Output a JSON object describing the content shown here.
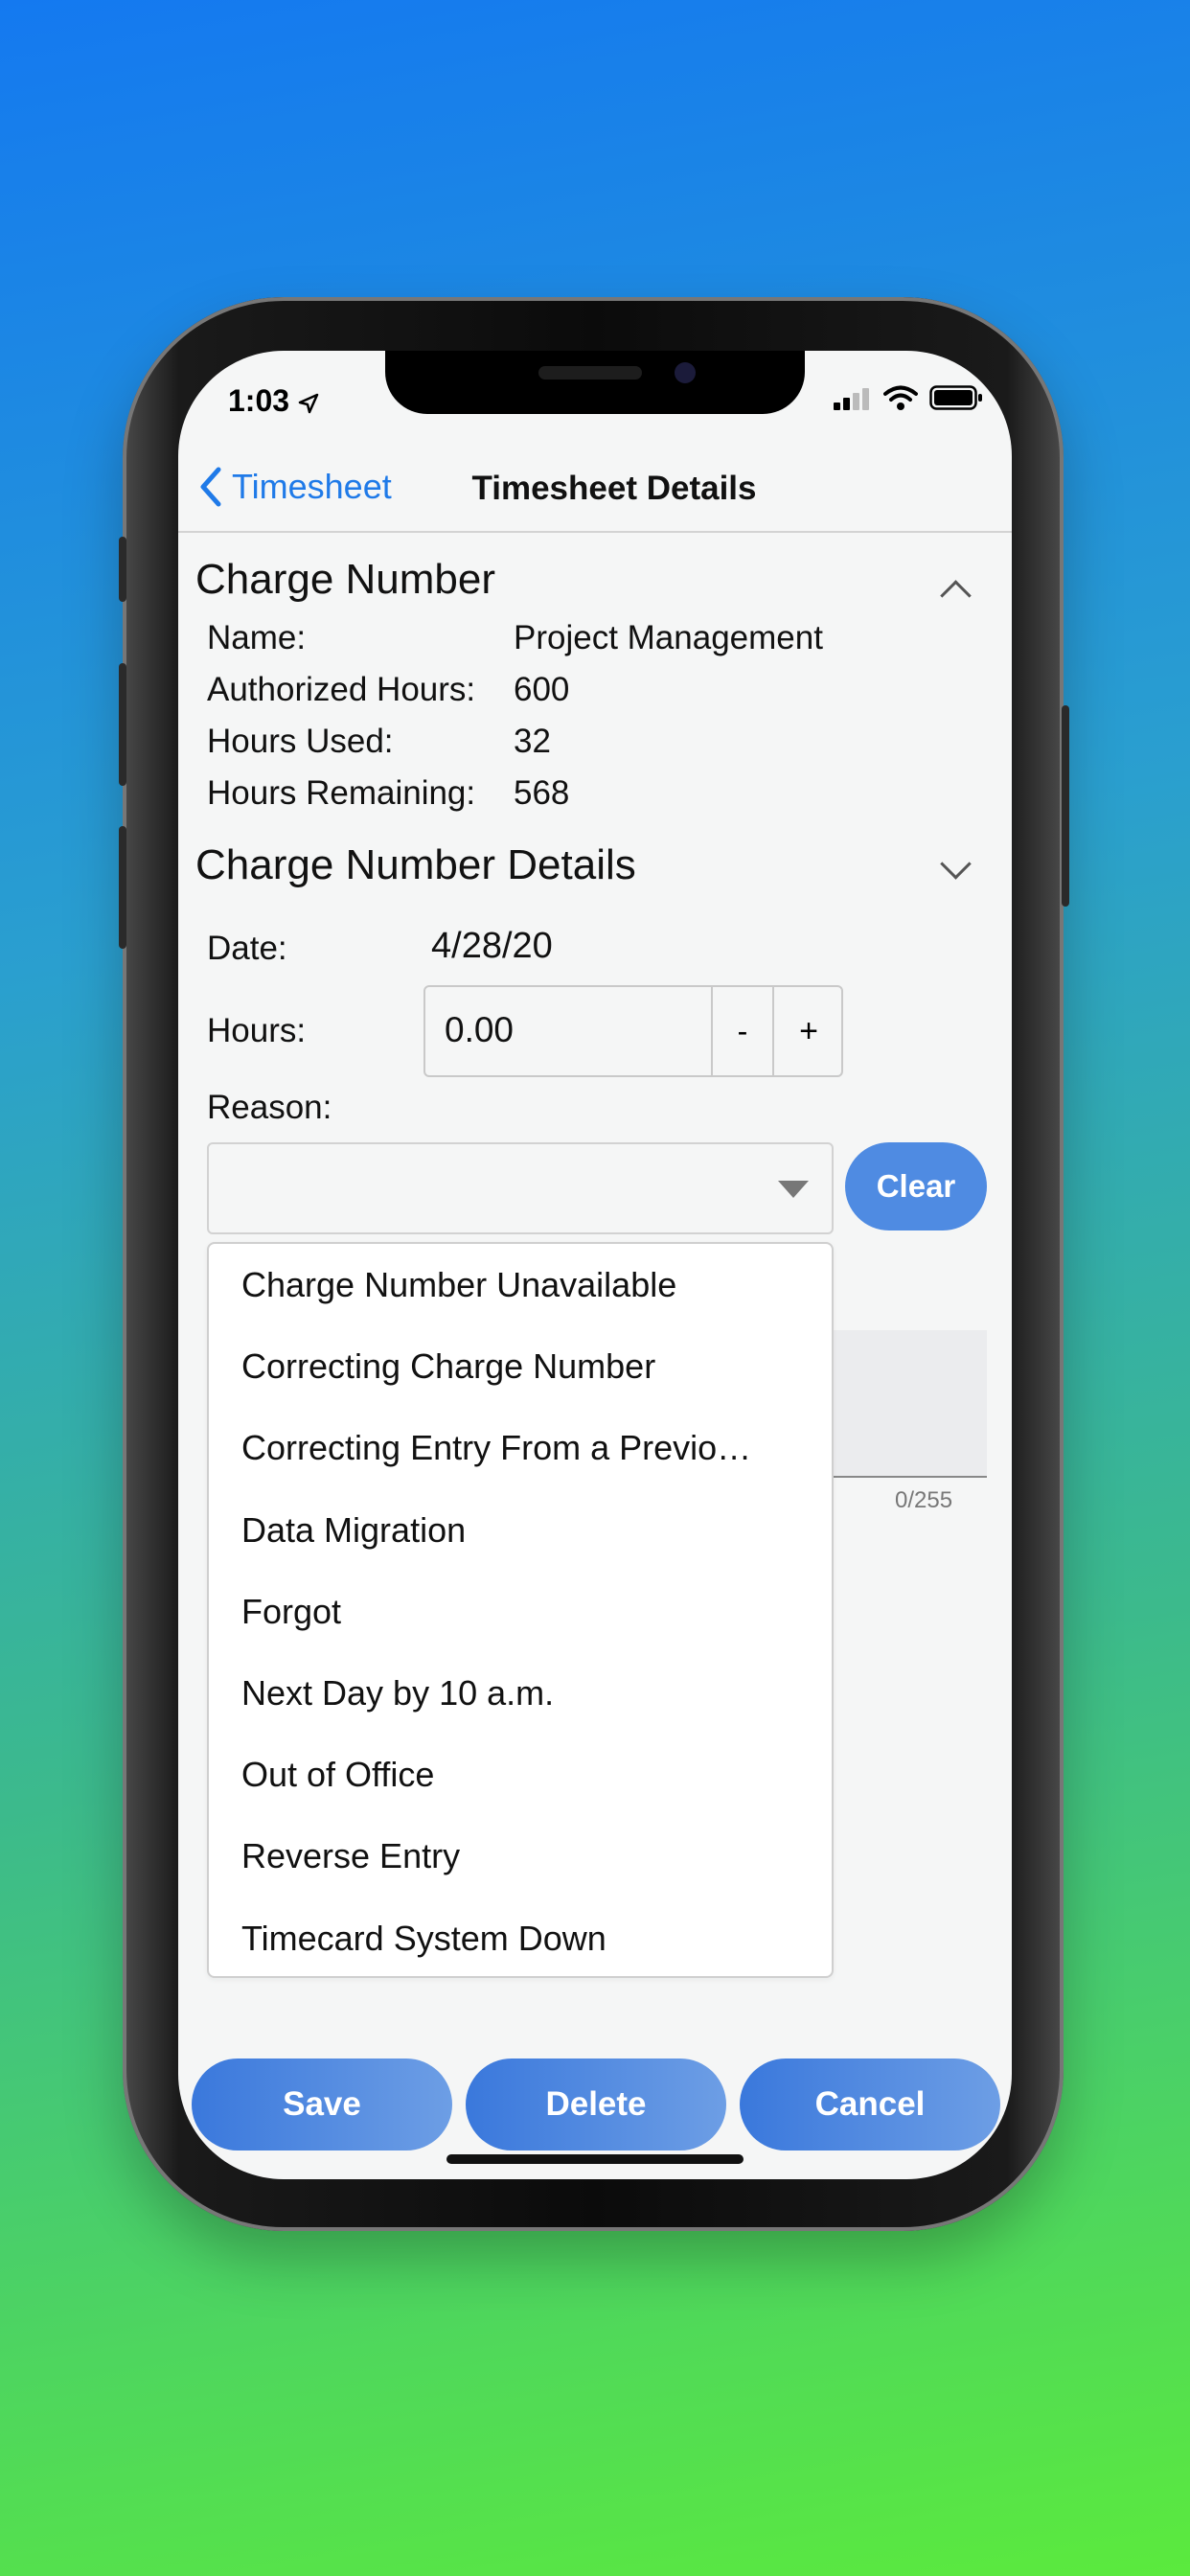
{
  "status_bar": {
    "time": "1:03"
  },
  "nav": {
    "back_label": "Timesheet",
    "title": "Timesheet Details"
  },
  "charge_number": {
    "header": "Charge Number",
    "rows": [
      {
        "label": "Name:",
        "value": "Project Management"
      },
      {
        "label": "Authorized Hours:",
        "value": "600"
      },
      {
        "label": "Hours Used:",
        "value": "32"
      },
      {
        "label": "Hours Remaining:",
        "value": "568"
      }
    ]
  },
  "details": {
    "header": "Charge Number Details",
    "date_label": "Date:",
    "date_value": "4/28/20",
    "hours_label": "Hours:",
    "hours_value": "0.00",
    "minus": "-",
    "plus": "+",
    "reason_label": "Reason:",
    "clear_label": "Clear",
    "counter": "0/255"
  },
  "dropdown": {
    "options": [
      "Charge Number Unavailable",
      "Correcting Charge Number",
      "Correcting Entry From a Previo…",
      "Data Migration",
      "Forgot",
      "Next Day by 10 a.m.",
      "Out of Office",
      "Reverse Entry",
      "Timecard System Down"
    ]
  },
  "footer": {
    "save": "Save",
    "delete": "Delete",
    "cancel": "Cancel"
  },
  "colors": {
    "accent": "#1f7ae8",
    "button": "#4f8be2"
  }
}
